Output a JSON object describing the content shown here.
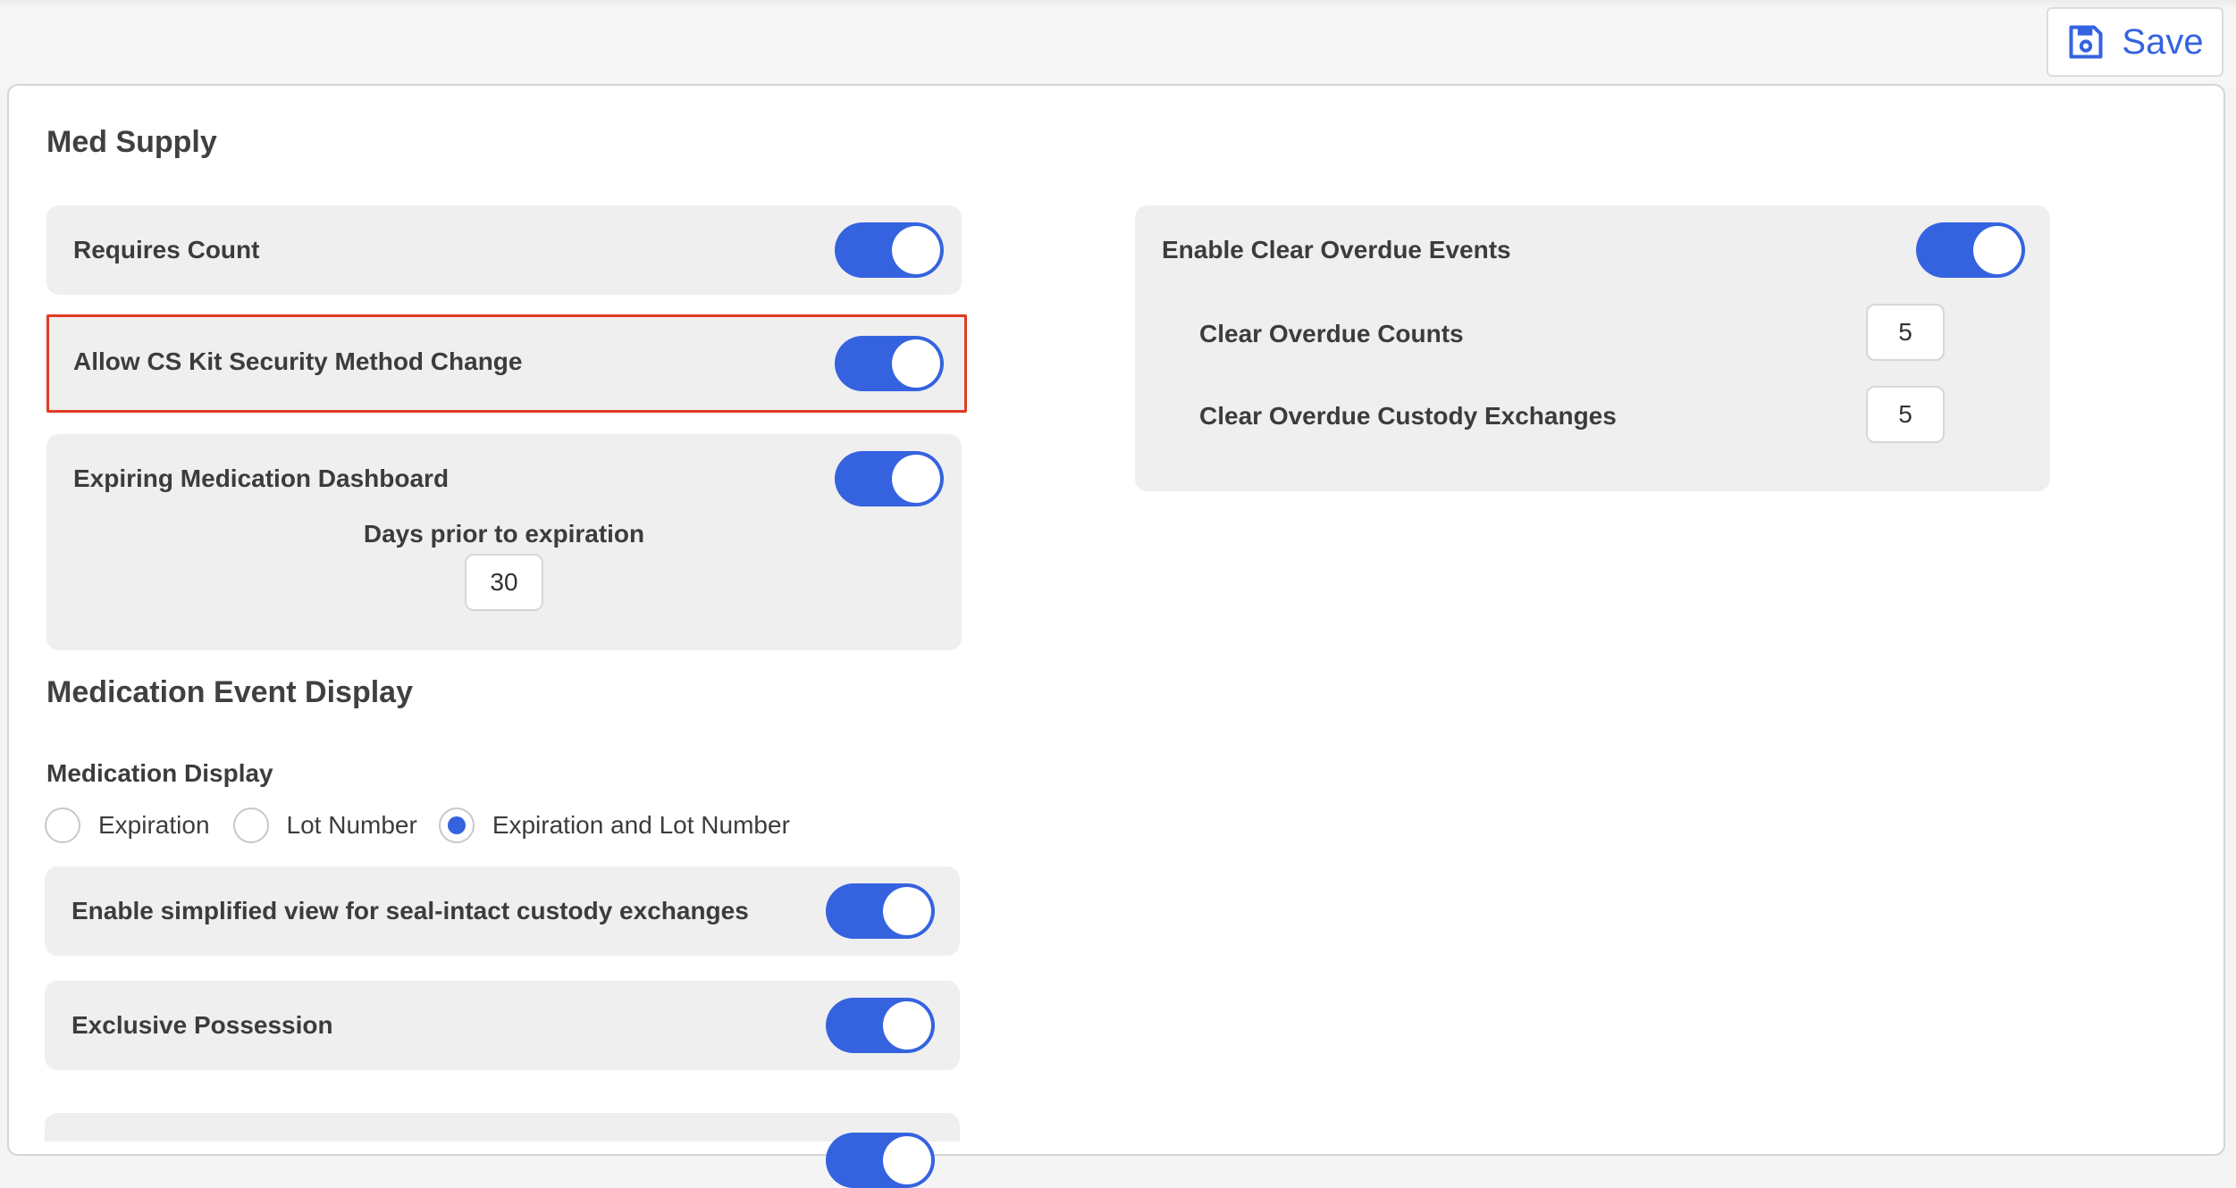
{
  "toolbar": {
    "save_label": "Save",
    "save_icon": "floppy-disk-icon"
  },
  "colors": {
    "accent": "#3563e0",
    "highlight_border": "#e03b22",
    "card_background": "#efefef"
  },
  "med_supply": {
    "title": "Med Supply",
    "requires_count": {
      "label": "Requires Count",
      "enabled": true
    },
    "allow_cs_kit": {
      "label": "Allow CS Kit Security Method Change",
      "enabled": true
    },
    "expiring_dashboard": {
      "label": "Expiring Medication Dashboard",
      "enabled": true,
      "days_label": "Days prior to expiration",
      "days_value": "30"
    },
    "clear_overdue": {
      "label": "Enable Clear Overdue Events",
      "enabled": true,
      "counts_label": "Clear Overdue Counts",
      "counts_value": "5",
      "custody_label": "Clear Overdue Custody Exchanges",
      "custody_value": "5"
    }
  },
  "medication_event_display": {
    "title": "Medication Event Display",
    "display_label": "Medication Display",
    "options": [
      {
        "label": "Expiration",
        "selected": false
      },
      {
        "label": "Lot Number",
        "selected": false
      },
      {
        "label": "Expiration and Lot Number",
        "selected": true
      }
    ],
    "simplified_view": {
      "label": "Enable simplified view for seal-intact custody exchanges",
      "enabled": true
    },
    "exclusive_possession": {
      "label": "Exclusive Possession",
      "enabled": true
    }
  }
}
